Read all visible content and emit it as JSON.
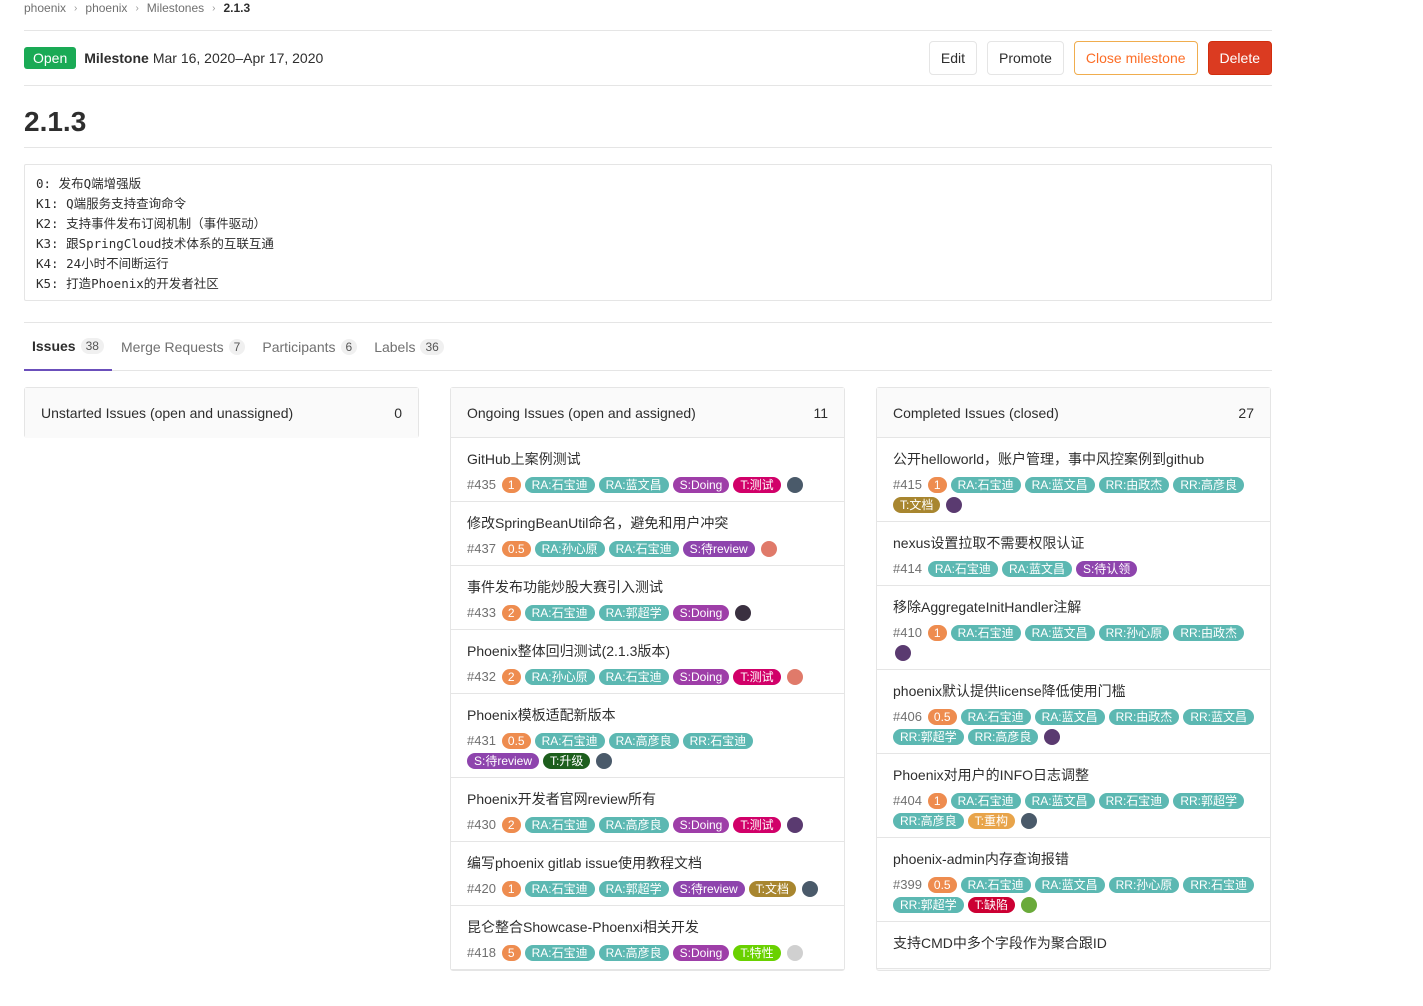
{
  "breadcrumb": [
    "phoenix",
    "phoenix",
    "Milestones",
    "2.1.3"
  ],
  "header": {
    "status": "Open",
    "milestone_label": "Milestone",
    "dates": "Mar 16, 2020–Apr 17, 2020",
    "edit": "Edit",
    "promote": "Promote",
    "close": "Close milestone",
    "delete": "Delete"
  },
  "title": "2.1.3",
  "description": [
    "0: 发布Q端增强版",
    "K1: Q端服务支持查询命令",
    "K2: 支持事件发布订阅机制（事件驱动）",
    "K3: 跟SpringCloud技术体系的互联互通",
    "K4: 24小时不间断运行",
    "K5: 打造Phoenix的开发者社区"
  ],
  "tabs": [
    {
      "label": "Issues",
      "count": "38"
    },
    {
      "label": "Merge Requests",
      "count": "7"
    },
    {
      "label": "Participants",
      "count": "6"
    },
    {
      "label": "Labels",
      "count": "36"
    }
  ],
  "colors": {
    "ra": "#5cb8b2",
    "rr": "#5cb8b2",
    "doing": "#9e3ea8",
    "test": "#d10069",
    "review": "#8e44ad",
    "doc": "#a8862f",
    "upgrade": "#1d5e1d",
    "feature": "#69d100",
    "refactor": "#e8a44a",
    "bug": "#cc0033",
    "weight": "#ee8c4f"
  },
  "boards": [
    {
      "title": "Unstarted Issues (open and unassigned)",
      "count": "0",
      "issues": []
    },
    {
      "title": "Ongoing Issues (open and assigned)",
      "count": "11",
      "issues": [
        {
          "title": "GitHub上案例测试",
          "num": "#435",
          "weight": "1",
          "labels": [
            [
              "RA:石宝迪",
              "ra"
            ],
            [
              "RA:蓝文昌",
              "ra"
            ],
            [
              "S:Doing",
              "doing"
            ],
            [
              "T:测试",
              "test"
            ]
          ],
          "avatar": "#4a5a6a"
        },
        {
          "title": "修改SpringBeanUtil命名，避免和用户冲突",
          "num": "#437",
          "weight": "0.5",
          "labels": [
            [
              "RA:孙心原",
              "ra"
            ],
            [
              "RA:石宝迪",
              "ra"
            ],
            [
              "S:待review",
              "review"
            ]
          ],
          "avatar": "#e07a6a"
        },
        {
          "title": "事件发布功能炒股大赛引入测试",
          "num": "#433",
          "weight": "2",
          "labels": [
            [
              "RA:石宝迪",
              "ra"
            ],
            [
              "RA:郭超学",
              "ra"
            ],
            [
              "S:Doing",
              "doing"
            ]
          ],
          "avatar": "#3a3040"
        },
        {
          "title": "Phoenix整体回归测试(2.1.3版本)",
          "num": "#432",
          "weight": "2",
          "labels": [
            [
              "RA:孙心原",
              "ra"
            ],
            [
              "RA:石宝迪",
              "ra"
            ],
            [
              "S:Doing",
              "doing"
            ],
            [
              "T:测试",
              "test"
            ]
          ],
          "avatar": "#e07a6a"
        },
        {
          "title": "Phoenix模板适配新版本",
          "num": "#431",
          "weight": "0.5",
          "labels": [
            [
              "RA:石宝迪",
              "ra"
            ],
            [
              "RA:高彦良",
              "ra"
            ],
            [
              "RR:石宝迪",
              "rr"
            ],
            [
              "S:待review",
              "review"
            ],
            [
              "T:升级",
              "upgrade"
            ]
          ],
          "avatar": "#4a5a6a"
        },
        {
          "title": "Phoenix开发者官网review所有",
          "num": "#430",
          "weight": "2",
          "labels": [
            [
              "RA:石宝迪",
              "ra"
            ],
            [
              "RA:高彦良",
              "ra"
            ],
            [
              "S:Doing",
              "doing"
            ],
            [
              "T:测试",
              "test"
            ]
          ],
          "avatar": "#5a3a70"
        },
        {
          "title": "编写phoenix gitlab issue使用教程文档",
          "num": "#420",
          "weight": "1",
          "labels": [
            [
              "RA:石宝迪",
              "ra"
            ],
            [
              "RA:郭超学",
              "ra"
            ],
            [
              "S:待review",
              "review"
            ],
            [
              "T:文档",
              "doc"
            ]
          ],
          "avatar": "#4a5a6a"
        },
        {
          "title": "昆仑整合Showcase-Phoenxi相关开发",
          "num": "#418",
          "weight": "5",
          "labels": [
            [
              "RA:石宝迪",
              "ra"
            ],
            [
              "RA:高彦良",
              "ra"
            ],
            [
              "S:Doing",
              "doing"
            ],
            [
              "T:特性",
              "feature"
            ]
          ],
          "avatar": "#d0d0d0"
        }
      ]
    },
    {
      "title": "Completed Issues (closed)",
      "count": "27",
      "issues": [
        {
          "title": "公开helloworld，账户管理，事中风控案例到github",
          "num": "#415",
          "weight": "1",
          "labels": [
            [
              "RA:石宝迪",
              "ra"
            ],
            [
              "RA:蓝文昌",
              "ra"
            ],
            [
              "RR:由政杰",
              "rr"
            ],
            [
              "RR:高彦良",
              "rr"
            ],
            [
              "T:文档",
              "doc"
            ]
          ],
          "avatar": "#5a3a70"
        },
        {
          "title": "nexus设置拉取不需要权限认证",
          "num": "#414",
          "weight": "",
          "labels": [
            [
              "RA:石宝迪",
              "ra"
            ],
            [
              "RA:蓝文昌",
              "ra"
            ],
            [
              "S:待认领",
              "review"
            ]
          ],
          "avatar": ""
        },
        {
          "title": "移除AggregateInitHandler注解",
          "num": "#410",
          "weight": "1",
          "labels": [
            [
              "RA:石宝迪",
              "ra"
            ],
            [
              "RA:蓝文昌",
              "ra"
            ],
            [
              "RR:孙心原",
              "rr"
            ],
            [
              "RR:由政杰",
              "rr"
            ]
          ],
          "avatar": "#5a3a70"
        },
        {
          "title": "phoenix默认提供license降低使用门槛",
          "num": "#406",
          "weight": "0.5",
          "labels": [
            [
              "RA:石宝迪",
              "ra"
            ],
            [
              "RA:蓝文昌",
              "ra"
            ],
            [
              "RR:由政杰",
              "rr"
            ],
            [
              "RR:蓝文昌",
              "rr"
            ],
            [
              "RR:郭超学",
              "rr"
            ],
            [
              "RR:高彦良",
              "rr"
            ]
          ],
          "avatar": "#5a3a70"
        },
        {
          "title": "Phoenix对用户的INFO日志调整",
          "num": "#404",
          "weight": "1",
          "labels": [
            [
              "RA:石宝迪",
              "ra"
            ],
            [
              "RA:蓝文昌",
              "ra"
            ],
            [
              "RR:石宝迪",
              "rr"
            ],
            [
              "RR:郭超学",
              "rr"
            ],
            [
              "RR:高彦良",
              "rr"
            ],
            [
              "T:重构",
              "refactor"
            ]
          ],
          "avatar": "#4a5a6a"
        },
        {
          "title": "phoenix-admin内存查询报错",
          "num": "#399",
          "weight": "0.5",
          "labels": [
            [
              "RA:石宝迪",
              "ra"
            ],
            [
              "RA:蓝文昌",
              "ra"
            ],
            [
              "RR:孙心原",
              "rr"
            ],
            [
              "RR:石宝迪",
              "rr"
            ],
            [
              "RR:郭超学",
              "rr"
            ],
            [
              "T:缺陷",
              "bug"
            ]
          ],
          "avatar": "#6aaa3a"
        },
        {
          "title": "支持CMD中多个字段作为聚合跟ID",
          "num": "",
          "weight": "",
          "labels": [],
          "avatar": ""
        }
      ]
    }
  ]
}
